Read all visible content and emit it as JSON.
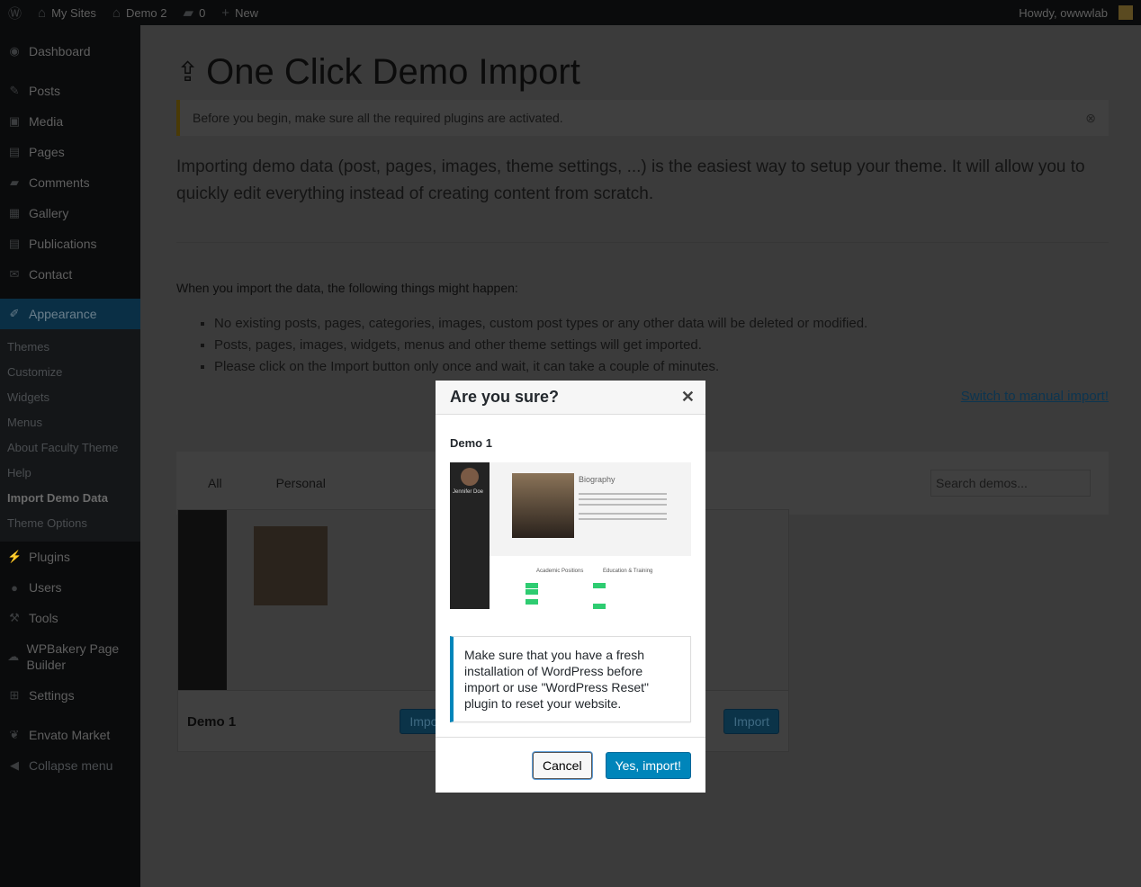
{
  "adminbar": {
    "my_sites": "My Sites",
    "site": "Demo 2",
    "comments": "0",
    "new": "New",
    "howdy": "Howdy, owwwlab"
  },
  "sidebar": {
    "items": [
      "Dashboard",
      "Posts",
      "Media",
      "Pages",
      "Comments",
      "Gallery",
      "Publications",
      "Contact",
      "Appearance"
    ],
    "sub": [
      "Themes",
      "Customize",
      "Widgets",
      "Menus",
      "About Faculty Theme",
      "Help",
      "Import Demo Data",
      "Theme Options"
    ],
    "items2": [
      "Plugins",
      "Users",
      "Tools",
      "WPBakery Page Builder",
      "Settings",
      "Envato Market",
      "Collapse menu"
    ]
  },
  "main": {
    "title": "One Click Demo Import",
    "notice": "Before you begin, make sure all the required plugins are activated.",
    "intro": "Importing demo data (post, pages, images, theme settings, ...) is the easiest way to setup your theme. It will allow you to quickly edit everything instead of creating content from scratch.",
    "when": "When you import the data, the following things might happen:",
    "bullets": [
      "No existing posts, pages, categories, images, custom post types or any other data will be deleted or modified.",
      "Posts, pages, images, widgets, menus and other theme settings will get imported.",
      "Please click on the Import button only once and wait, it can take a couple of minutes."
    ],
    "manual": "Switch to manual import!",
    "tabs": [
      "All",
      "Personal"
    ],
    "search_placeholder": "Search demos...",
    "cards": [
      {
        "name": "Demo 1",
        "button": "Import"
      },
      {
        "name": "",
        "button": "Import"
      }
    ]
  },
  "preview": {
    "name": "Jennifer Doe",
    "bio": "Biography",
    "academic": "Academic Positions",
    "education": "Education & Training"
  },
  "modal": {
    "title": "Are you sure?",
    "demo": "Demo 1",
    "warning": "Make sure that you have a fresh installation of WordPress before import or use \"WordPress Reset\" plugin to reset your website.",
    "cancel": "Cancel",
    "confirm": "Yes, import!"
  }
}
